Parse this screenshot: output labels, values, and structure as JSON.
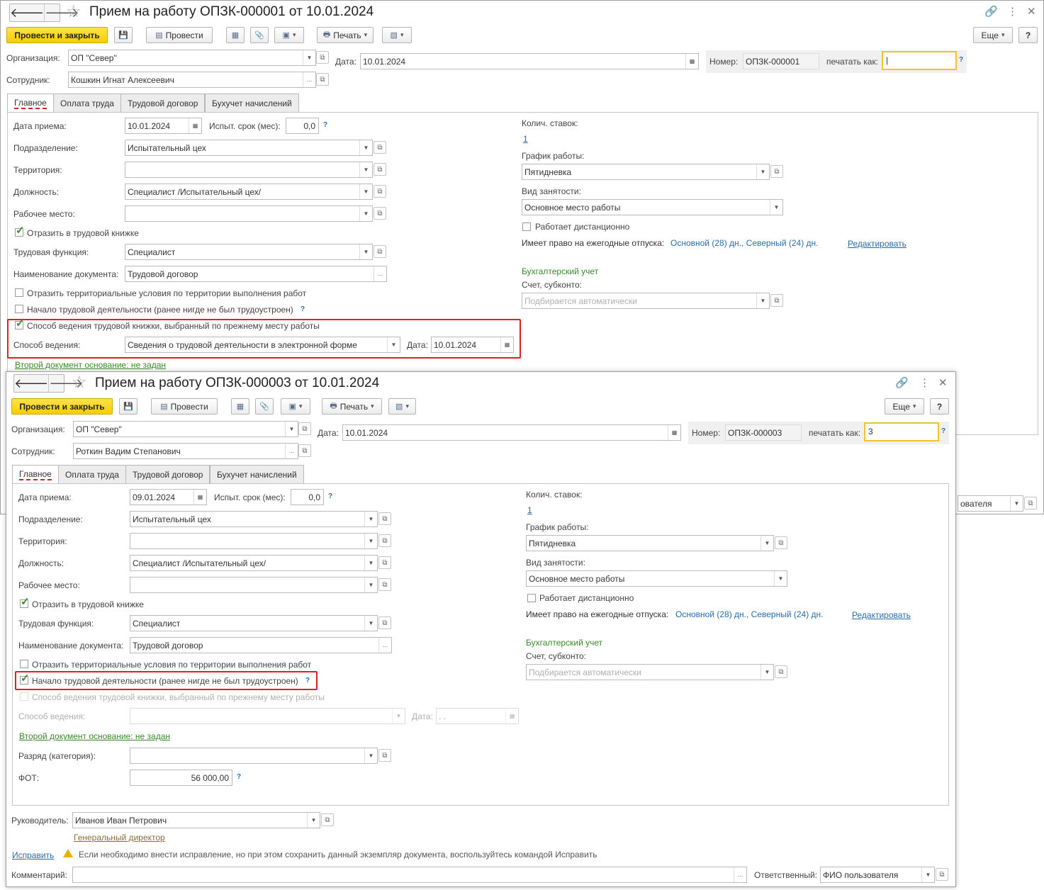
{
  "w1": {
    "title": "Прием на работу ОПЗК-000001 от 10.01.2024",
    "toolbar": {
      "post_close": "Провести и закрыть",
      "post": "Провести",
      "print": "Печать",
      "more": "Еще",
      "help": "?"
    },
    "org_label": "Организация:",
    "org": "ОП \"Север\"",
    "date_label": "Дата:",
    "date": "10.01.2024",
    "num_label": "Номер:",
    "num": "ОПЗК-000001",
    "printas_label": "печатать как:",
    "printas": "|",
    "emp_label": "Сотрудник:",
    "emp": "Кошкин Игнат Алексеевич",
    "tabs": [
      "Главное",
      "Оплата труда",
      "Трудовой договор",
      "Бухучет начислений"
    ],
    "hire_label": "Дата приема:",
    "hire": "10.01.2024",
    "trial_label": "Испыт. срок (мес):",
    "trial": "0,0",
    "dept_label": "Подразделение:",
    "dept": "Испытательный цех",
    "terr_label": "Территория:",
    "terr": "",
    "pos_label": "Должность:",
    "pos": "Специалист /Испытательный цех/",
    "wp_label": "Рабочее место:",
    "wp": "",
    "book": "Отразить в трудовой книжке",
    "func_label": "Трудовая функция:",
    "func": "Специалист",
    "doc_label": "Наименование документа:",
    "doc": "Трудовой договор",
    "terrcond": "Отразить территориальные условия по территории выполнения работ",
    "start": "Начало трудовой деятельности (ранее нигде не был трудоустроен)",
    "method_chk": "Способ ведения трудовой книжки, выбранный по прежнему месту работы",
    "method_label": "Способ ведения:",
    "method": "Сведения о трудовой деятельности в электронной форме",
    "mdate_label": "Дата:",
    "mdate": "10.01.2024",
    "second": "Второй документ основание: не задан",
    "rates_label": "Колич. ставок:",
    "rates": "1",
    "sched_label": "График работы:",
    "sched": "Пятидневка",
    "emptype_label": "Вид занятости:",
    "emptype": "Основное место работы",
    "remote": "Работает дистанционно",
    "vac_label": "Имеет право на ежегодные отпуска:",
    "vac": "Основной (28) дн., Северный (24) дн.",
    "edit": "Редактировать",
    "acc": "Бухгалтерский учет",
    "acc_label": "Счет, субконто:",
    "acc_ph": "Подбирается автоматически",
    "resp_tail": "ователя"
  },
  "w2": {
    "title": "Прием на работу ОПЗК-000003 от 10.01.2024",
    "toolbar": {
      "post_close": "Провести и закрыть",
      "post": "Провести",
      "print": "Печать",
      "more": "Еще",
      "help": "?"
    },
    "org_label": "Организация:",
    "org": "ОП \"Север\"",
    "date_label": "Дата:",
    "date": "10.01.2024",
    "num_label": "Номер:",
    "num": "ОПЗК-000003",
    "printas_label": "печатать как:",
    "printas": "3",
    "emp_label": "Сотрудник:",
    "emp": "Роткин Вадим Степанович",
    "tabs": [
      "Главное",
      "Оплата труда",
      "Трудовой договор",
      "Бухучет начислений"
    ],
    "hire_label": "Дата приема:",
    "hire": "09.01.2024",
    "trial_label": "Испыт. срок (мес):",
    "trial": "0,0",
    "dept_label": "Подразделение:",
    "dept": "Испытательный цех",
    "terr_label": "Территория:",
    "terr": "",
    "pos_label": "Должность:",
    "pos": "Специалист /Испытательный цех/",
    "wp_label": "Рабочее место:",
    "wp": "",
    "book": "Отразить в трудовой книжке",
    "func_label": "Трудовая функция:",
    "func": "Специалист",
    "doc_label": "Наименование документа:",
    "doc": "Трудовой договор",
    "terrcond": "Отразить территориальные условия по территории выполнения работ",
    "start": "Начало трудовой деятельности (ранее нигде не был трудоустроен)",
    "method_chk": "Способ ведения трудовой книжки, выбранный по прежнему месту работы",
    "method_label": "Способ ведения:",
    "mdate_label": "Дата:",
    "mdate": " .  .",
    "second": "Второй документ основание: не задан",
    "grade_label": "Разряд (категория):",
    "grade": "",
    "fot_label": "ФОТ:",
    "fot": "56 000,00",
    "rates_label": "Колич. ставок:",
    "rates": "1",
    "sched_label": "График работы:",
    "sched": "Пятидневка",
    "emptype_label": "Вид занятости:",
    "emptype": "Основное место работы",
    "remote": "Работает дистанционно",
    "vac_label": "Имеет право на ежегодные отпуска:",
    "vac": "Основной (28) дн., Северный (24) дн.",
    "edit": "Редактировать",
    "acc": "Бухгалтерский учет",
    "acc_label": "Счет, субконто:",
    "acc_ph": "Подбирается автоматически",
    "mgr_label": "Руководитель:",
    "mgr": "Иванов Иван Петрович",
    "mgr_pos": "Генеральный директор",
    "fix": "Исправить",
    "fix_note": "Если необходимо внести исправление, но при этом сохранить данный экземпляр документа, воспользуйтесь командой Исправить",
    "comment_label": "Комментарий:",
    "comment": "",
    "resp_label": "Ответственный:",
    "resp": "ФИО пользователя"
  }
}
